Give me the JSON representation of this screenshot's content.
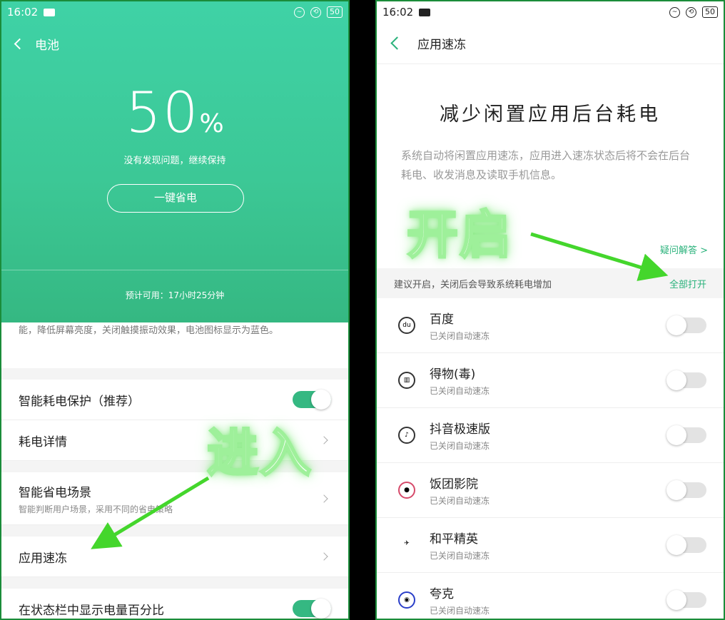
{
  "status_bar": {
    "time": "16:02",
    "battery": "50"
  },
  "left": {
    "nav_title": "电池",
    "battery_percent": "50",
    "percent_sign": "%",
    "status_note": "没有发现问题，继续保持",
    "save_button": "一键省电",
    "estimate": "预计可用：17小时25分钟",
    "desc_tail": "能，降低屏幕亮度，关闭触摸振动效果，电池图标显示为蓝色。",
    "rows": [
      {
        "label": "智能耗电保护（推荐）",
        "sub": "",
        "control": "toggle-on"
      },
      {
        "label": "耗电详情",
        "sub": "",
        "control": "chevron"
      },
      {
        "label": "智能省电场景",
        "sub": "智能判断用户场景，采用不同的省电策略",
        "control": "chevron"
      },
      {
        "label": "应用速冻",
        "sub": "",
        "control": "chevron"
      },
      {
        "label": "在状态栏中显示电量百分比",
        "sub": "",
        "control": "toggle-on"
      }
    ],
    "annotation": "进入"
  },
  "right": {
    "nav_title": "应用速冻",
    "headline": "减少闲置应用后台耗电",
    "description": "系统自动将闲置应用速冻，应用进入速冻状态后将不会在后台耗电、收发消息及读取手机信息。",
    "faq_link": "疑问解答 >",
    "hint": "建议开启，关闭后会导致系统耗电增加",
    "open_all": "全部打开",
    "apps": [
      {
        "name": "百度",
        "state": "已关闭自动速冻",
        "toggle": "off"
      },
      {
        "name": "得物(毒)",
        "state": "已关闭自动速冻",
        "toggle": "off"
      },
      {
        "name": "抖音极速版",
        "state": "已关闭自动速冻",
        "toggle": "off"
      },
      {
        "name": "饭团影院",
        "state": "已关闭自动速冻",
        "toggle": "off"
      },
      {
        "name": "和平精英",
        "state": "已关闭自动速冻",
        "toggle": "off"
      },
      {
        "name": "夸克",
        "state": "已关闭自动速冻",
        "toggle": "off"
      }
    ],
    "annotation": "开启"
  },
  "colors": {
    "accent": "#35b882",
    "arrow": "#44d62c"
  }
}
